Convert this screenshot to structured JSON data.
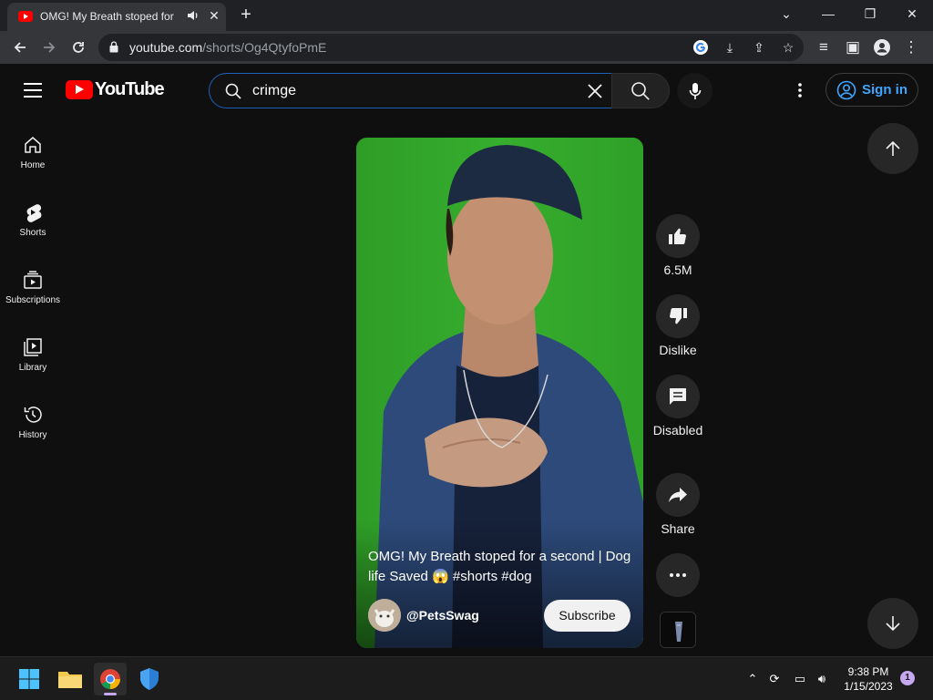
{
  "browser": {
    "tab_title": "OMG! My Breath stoped for a second | Dog life Saved",
    "url_host": "youtube.com",
    "url_path": "/shorts/Og4QtyfoPmE"
  },
  "header": {
    "logo_text": "YouTube",
    "search_value": "crimge",
    "signin_label": "Sign in"
  },
  "sidebar": {
    "items": [
      {
        "label": "Home",
        "icon": "home-icon"
      },
      {
        "label": "Shorts",
        "icon": "shorts-icon"
      },
      {
        "label": "Subscriptions",
        "icon": "subscriptions-icon"
      },
      {
        "label": "Library",
        "icon": "library-icon"
      },
      {
        "label": "History",
        "icon": "history-icon"
      }
    ]
  },
  "video": {
    "title": "OMG! My Breath stoped for a second | Dog life Saved 😱 #shorts #dog",
    "channel": "@PetsSwag",
    "subscribe_label": "Subscribe"
  },
  "actions": {
    "like_count": "6.5M",
    "dislike_label": "Dislike",
    "comments_label": "Disabled",
    "share_label": "Share"
  },
  "taskbar": {
    "time": "9:38 PM",
    "date": "1/15/2023",
    "notifications": "1"
  },
  "colors": {
    "youtube_red": "#ff0000",
    "link_blue": "#3ea6ff",
    "background": "#0f0f0f"
  }
}
